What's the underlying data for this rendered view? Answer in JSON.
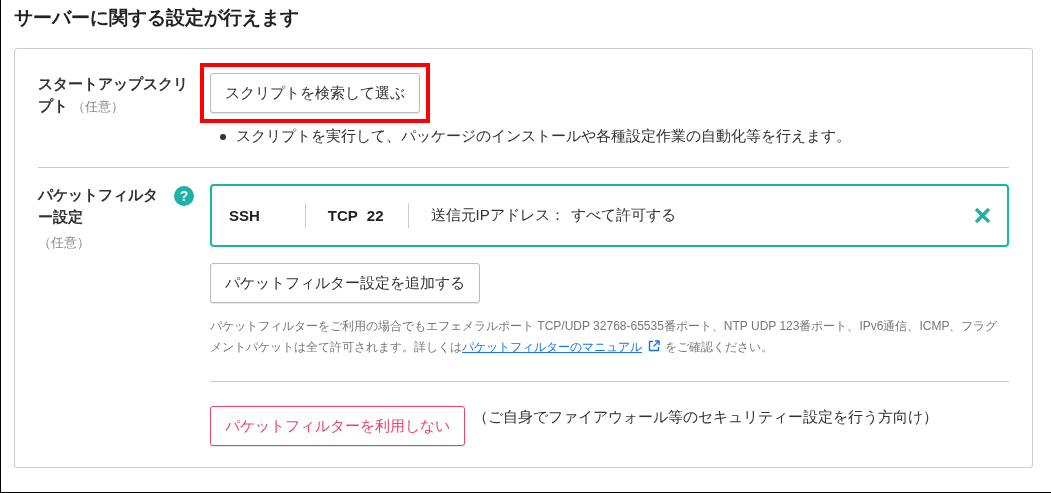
{
  "title": "サーバーに関する設定が行えます",
  "sections": [
    {
      "kind": "startup_script",
      "label": "スタートアップスクリプト",
      "optional": "（任意）",
      "button": {
        "label": "スクリプトを検索して選ぶ",
        "highlighted": true
      },
      "bullets": [
        "スクリプトを実行して、パッケージのインストールや各種設定作業の自動化等を行えます。"
      ]
    },
    {
      "kind": "packet_filter",
      "label": "パケットフィルター設定",
      "optional": "（任意）",
      "help": "?",
      "rules": [
        {
          "name": "SSH",
          "protocol": "TCP",
          "port": "22",
          "source_label": "送信元IPアドレス：",
          "source_value": "すべて許可する"
        }
      ],
      "add_button": "パケットフィルター設定を追加する",
      "note": {
        "before": "パケットフィルターをご利用の場合でもエフェメラルポート TCP/UDP 32768-65535番ポート、NTP UDP 123番ポート、IPv6通信、ICMP、フラグメントパケットは全て許可されます。詳しくは",
        "link": "パケットフィルターのマニュアル",
        "after": "をご確認ください。"
      },
      "disable_button": "パケットフィルターを利用しない",
      "disable_note": "（ご自身でファイアウォール等のセキュリティー設定を行う方向け）"
    }
  ]
}
